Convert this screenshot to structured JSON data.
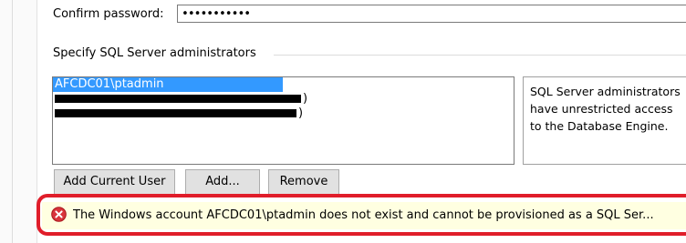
{
  "confirm_password": {
    "label": "Confirm password:",
    "value": "•••••••••••"
  },
  "administrators_group": {
    "title": "Specify SQL Server administrators",
    "list_items": [
      {
        "label": "AFCDC01\\ptadmin",
        "selected": true
      },
      {
        "label": ")",
        "redacted": true
      },
      {
        "label": ")",
        "redacted": true
      }
    ],
    "description": "SQL Server administrators\nhave unrestricted access\nto the Database Engine."
  },
  "buttons": {
    "add_current_user": "Add Current User",
    "add": "Add...",
    "remove": "Remove"
  },
  "error": {
    "icon": "error-x-icon",
    "message": "The Windows account AFCDC01\\ptadmin does not exist and cannot be provisioned as a SQL Ser..."
  },
  "colors": {
    "selection": "#3399ff",
    "error_highlight": "#e01d2a",
    "error_background": "#ffffe1"
  }
}
